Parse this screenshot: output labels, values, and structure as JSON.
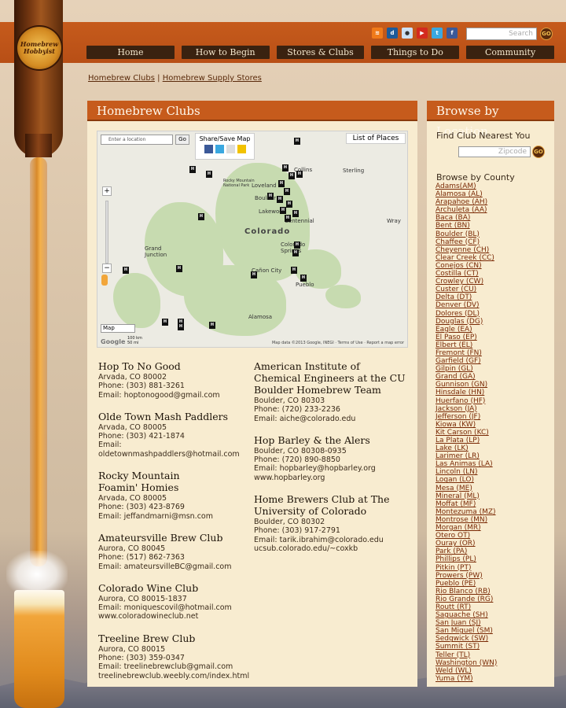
{
  "site": {
    "logo_lines": [
      "Homebrew",
      "Hobbyist"
    ]
  },
  "header": {
    "social_icons": [
      "rss-icon",
      "digg-icon",
      "reddit-icon",
      "youtube-icon",
      "twitter-icon",
      "facebook-icon"
    ],
    "search_placeholder": "Search",
    "search_go": "GO"
  },
  "nav": {
    "items": [
      "Home",
      "How to Begin",
      "Stores & Clubs",
      "Things to Do",
      "Community"
    ]
  },
  "breadcrumb": {
    "links": [
      "Homebrew Clubs",
      "Homebrew Supply Stores"
    ],
    "separator": "|"
  },
  "main": {
    "title": "Homebrew Clubs",
    "map": {
      "location_placeholder": "Enter a location",
      "go_label": "Go",
      "share_label": "Share/Save Map",
      "list_label": "List of Places",
      "type_label": "Map",
      "state_label": "Colorado",
      "places": [
        "Collins",
        "Sterling",
        "Rocky Mountain National Park",
        "Loveland",
        "Boulder",
        "Lakewood",
        "Centennial",
        "Grand Junction",
        "Colorado Springs",
        "Cañon City",
        "Pueblo",
        "Alamosa",
        "Wray"
      ],
      "scale": [
        "100 km",
        "50 mi"
      ],
      "attribution": "Map data ©2013 Google, INEGI · Terms of Use · Report a map error",
      "google": "Google"
    },
    "clubs_left": [
      {
        "name": "Hop To No Good",
        "lines": [
          "Arvada, CO 80002",
          "Phone: (303) 881-3261",
          "Email: hoptonogood@gmail.com"
        ]
      },
      {
        "name": "Olde Town Mash Paddlers",
        "lines": [
          "Arvada, CO 80005",
          "Phone: (303) 421-1874",
          "Email:",
          "oldetownmashpaddlers@hotmail.com"
        ]
      },
      {
        "name": "Rocky Mountain Foamin' Homies",
        "lines": [
          "Arvada, CO 80005",
          "Phone: (303) 423-8769",
          "Email: jeffandmarni@msn.com"
        ]
      },
      {
        "name": "Amateursville Brew Club",
        "lines": [
          "Aurora, CO 80045",
          "Phone: (517) 862-7363",
          "Email: amateursvilleBC@gmail.com"
        ]
      },
      {
        "name": "Colorado Wine Club",
        "lines": [
          "Aurora, CO 80015-1837",
          "Email: moniquescovil@hotmail.com",
          "www.coloradowineclub.net"
        ]
      },
      {
        "name": "Treeline Brew Club",
        "lines": [
          "Aurora, CO 80015",
          "Phone: (303) 359-0347",
          "Email: treelinebrewclub@gmail.com",
          "treelinebrewclub.weebly.com/index.html"
        ]
      }
    ],
    "clubs_right": [
      {
        "name": "American Institute of Chemical Engineers at the CU Boulder Homebrew Team",
        "lines": [
          "Boulder, CO 80303",
          "Phone: (720) 233-2236",
          "Email: aiche@colorado.edu"
        ]
      },
      {
        "name": "Hop Barley & the Alers",
        "lines": [
          "Boulder, CO 80308-0935",
          "Phone: (720) 890-8850",
          "Email: hopbarley@hopbarley.org",
          "www.hopbarley.org"
        ]
      },
      {
        "name": "Home Brewers Club at The University of Colorado",
        "lines": [
          "Boulder, CO 80302",
          "Phone: (303) 917-2791",
          "Email: tarik.ibrahim@colorado.edu",
          "ucsub.colorado.edu/~coxkb"
        ]
      }
    ]
  },
  "sidebar": {
    "title": "Browse by Location",
    "find_label": "Find Club Nearest You",
    "zip_placeholder": "Zipcode",
    "zip_go": "GO",
    "county_title": "Browse by County",
    "counties": [
      "Adams(AM)",
      "Alamosa (AL)",
      "Arapahoe (AH)",
      "Archuleta (AA)",
      "Baca (BA)",
      "Bent (BN)",
      "Boulder (BL)",
      "Chaffee (CF)",
      "Cheyenne (CH)",
      "Clear Creek (CC)",
      "Conejos (CN)",
      "Costilla (CT)",
      "Crowley (CW)",
      "Custer (CU)",
      "Delta (DT)",
      "Denver (DV)",
      "Dolores (DL)",
      "Douglas (DG)",
      "Eagle (EA)",
      "El Paso (EP)",
      "Elbert (EL)",
      "Fremont (FN)",
      "Garfield (GF)",
      "Gilpin (GL)",
      "Grand (GA)",
      "Gunnison (GN)",
      "Hinsdale (HN)",
      "Huerfano (HF)",
      "Jackson (JA)",
      "Jefferson (JF)",
      "Kiowa (KW)",
      "Kit Carson (KC)",
      "La Plata (LP)",
      "Lake (LK)",
      "Larimer (LR)",
      "Las Animas (LA)",
      "Lincoln (LN)",
      "Logan (LO)",
      "Mesa (ME)",
      "Mineral (ML)",
      "Moffat (MF)",
      "Montezuma (MZ)",
      "Montrose (MN)",
      "Morgan (MR)",
      "Otero OT)",
      "Ouray (OR)",
      "Park (PA)",
      "Phillips (PL)",
      "Pitkin (PT)",
      "Prowers (PW)",
      "Pueblo (PE)",
      "Rio Blanco (RB)",
      "Rio Grande (RG)",
      "Routt (RT)",
      "Saguache (SH)",
      "San Juan (SJ)",
      "San Miguel (SM)",
      "Sedgwick (SW)",
      "Summit (ST)",
      "Teller (TL)",
      "Washington (WN)",
      "Weld (WL)",
      "Yuma (YM)"
    ]
  },
  "colors": {
    "brand_orange": "#c65b1c",
    "nav_dark": "#3a2210",
    "panel_bg": "#f8ecd0",
    "link": "#7a2a06"
  }
}
